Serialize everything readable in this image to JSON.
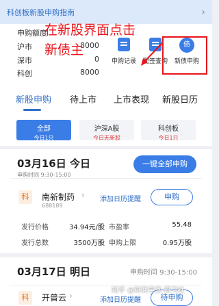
{
  "banner": {
    "text": "科创板新股申购指南",
    "arrow": "›"
  },
  "quota": {
    "title": "申购额度",
    "rows": [
      {
        "label": "沪市",
        "value": "8000"
      },
      {
        "label": "深市",
        "value": "0"
      },
      {
        "label": "科创",
        "value": "8000"
      }
    ]
  },
  "ops": [
    {
      "label": "申购记录",
      "icon": "document-icon"
    },
    {
      "label": "配签查询",
      "icon": "query-icon"
    },
    {
      "label": "新债申购",
      "icon": "bond-icon",
      "glyph": "债"
    }
  ],
  "annotation": {
    "line1": "在新股界面点击",
    "line2": "新债主",
    "color": "#e8141b"
  },
  "tabs": [
    "新股申购",
    "待上市",
    "上市表现",
    "新股日历"
  ],
  "filters": [
    {
      "label": "全部",
      "sub": "今日1只"
    },
    {
      "label": "沪深A股",
      "sub": "今日无新股"
    },
    {
      "label": "科创板",
      "sub": "今日1只"
    }
  ],
  "day1": {
    "title": "03月16日 今日",
    "time": "申购时间 9:30-15:00",
    "button": "一键全部申购",
    "stock": {
      "tag": "科",
      "name": "南新制药",
      "code": "688189",
      "chevron": "›",
      "remind": "添加日历提醒",
      "apply": "申购",
      "fields": [
        {
          "label": "发行价格",
          "value": "34.94元/股"
        },
        {
          "label": "市盈率",
          "value": "55.48"
        },
        {
          "label": "发行总数",
          "value": "3500万股"
        },
        {
          "label": "申购上限",
          "value": "0.95万股"
        }
      ]
    }
  },
  "day2": {
    "title": "03月17日 明日",
    "time": "申购时间 9:30-15:00",
    "stock": {
      "tag": "科",
      "name": "开普云",
      "chevron": "›",
      "remind": "添加日历提醒",
      "apply": "待申购"
    }
  },
  "watermark": "知乎 @财商学堂-研习社",
  "colors": {
    "accent": "#3b7de6",
    "annotation": "#e8141b",
    "tag_bg": "#fdeee2"
  }
}
